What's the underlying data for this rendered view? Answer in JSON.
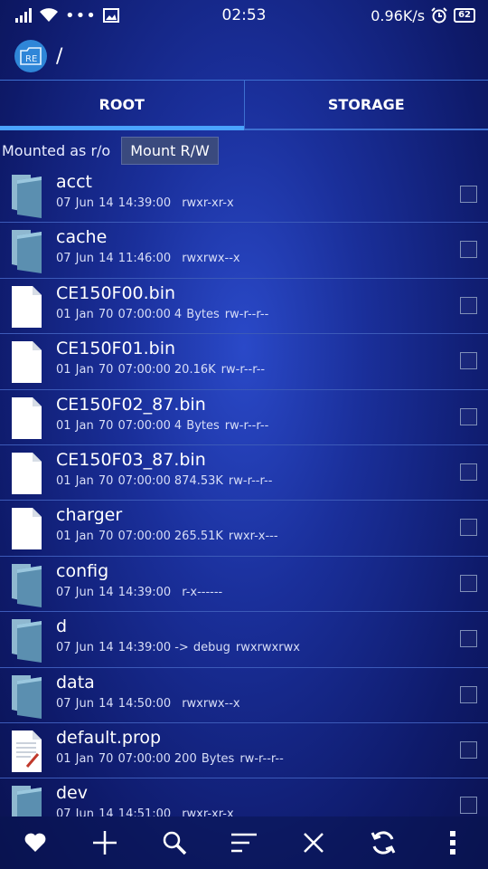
{
  "status_bar": {
    "time": "02:53",
    "speed": "0.96K/s",
    "battery": "62"
  },
  "app_bar": {
    "logo_text": "RE",
    "path": "/"
  },
  "tabs": [
    {
      "label": "ROOT",
      "active": true
    },
    {
      "label": "STORAGE",
      "active": false
    }
  ],
  "mount": {
    "status": "Mounted as r/o",
    "button": "Mount R/W"
  },
  "files": [
    {
      "name": "acct",
      "type": "folder",
      "date": "07 Jun 14 14:39:00",
      "size": "",
      "perms": "rwxr-xr-x"
    },
    {
      "name": "cache",
      "type": "folder",
      "date": "07 Jun 14 11:46:00",
      "size": "",
      "perms": "rwxrwx--x"
    },
    {
      "name": "CE150F00.bin",
      "type": "file",
      "date": "01 Jan 70 07:00:00",
      "size": "4 Bytes",
      "perms": "rw-r--r--"
    },
    {
      "name": "CE150F01.bin",
      "type": "file",
      "date": "01 Jan 70 07:00:00",
      "size": "20.16K",
      "perms": "rw-r--r--"
    },
    {
      "name": "CE150F02_87.bin",
      "type": "file",
      "date": "01 Jan 70 07:00:00",
      "size": "4 Bytes",
      "perms": "rw-r--r--"
    },
    {
      "name": "CE150F03_87.bin",
      "type": "file",
      "date": "01 Jan 70 07:00:00",
      "size": "874.53K",
      "perms": "rw-r--r--"
    },
    {
      "name": "charger",
      "type": "file",
      "date": "01 Jan 70 07:00:00",
      "size": "265.51K",
      "perms": "rwxr-x---"
    },
    {
      "name": "config",
      "type": "folder",
      "date": "07 Jun 14 14:39:00",
      "size": "",
      "perms": "r-x------"
    },
    {
      "name": "d",
      "type": "folder",
      "date": "07 Jun 14 14:39:00",
      "size": "-> debug",
      "perms": "rwxrwxrwx"
    },
    {
      "name": "data",
      "type": "folder",
      "date": "07 Jun 14 14:50:00",
      "size": "",
      "perms": "rwxrwx--x"
    },
    {
      "name": "default.prop",
      "type": "text-file",
      "date": "01 Jan 70 07:00:00",
      "size": "200 Bytes",
      "perms": "rw-r--r--"
    },
    {
      "name": "dev",
      "type": "folder",
      "date": "07 Jun 14 14:51:00",
      "size": "",
      "perms": "rwxr-xr-x"
    }
  ],
  "toolbar": [
    "favorite-icon",
    "add-icon",
    "search-icon",
    "sort-icon",
    "close-icon",
    "refresh-icon",
    "more-icon"
  ],
  "colors": {
    "accent": "#4aa3ff",
    "divider": "#3c5ab8",
    "folder": "#5b8fb0"
  }
}
